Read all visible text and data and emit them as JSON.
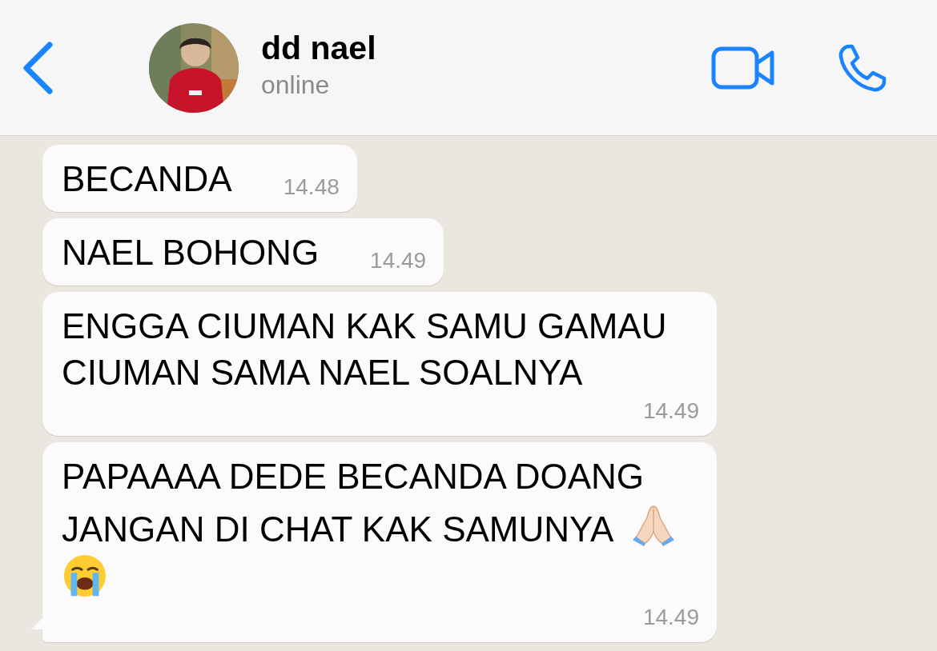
{
  "header": {
    "name": "dd nael",
    "status": "online"
  },
  "messages": [
    {
      "text": "BECANDA",
      "time": "14.48",
      "tail": false
    },
    {
      "text": "NAEL BOHONG",
      "time": "14.49",
      "tail": false
    },
    {
      "text": "ENGGA CIUMAN KAK SAMU GAMAU CIUMAN SAMA NAEL SOALNYA",
      "time": "14.49",
      "tail": false
    },
    {
      "text": "PAPAAAA DEDE BECANDA DOANG JANGAN DI CHAT KAK SAMUNYA",
      "time": "14.49",
      "tail": true,
      "icons": [
        {
          "kind": "praying-hands"
        },
        {
          "kind": "crying-face"
        }
      ]
    }
  ]
}
